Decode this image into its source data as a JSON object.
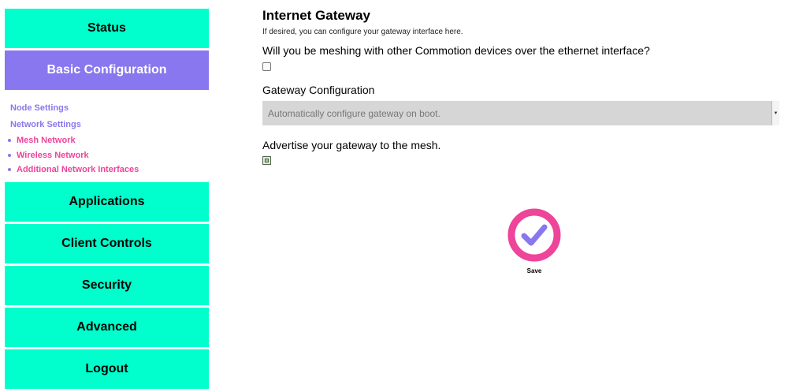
{
  "sidebar": {
    "top_items": [
      {
        "label": "Status"
      },
      {
        "label": "Basic Configuration"
      }
    ],
    "sub_links": [
      "Node Settings",
      "Network Settings"
    ],
    "sub_bullets": [
      "Mesh Network",
      "Wireless Network",
      "Additional Network Interfaces"
    ],
    "bottom_items": [
      {
        "label": "Applications"
      },
      {
        "label": "Client Controls"
      },
      {
        "label": "Security"
      },
      {
        "label": "Advanced"
      },
      {
        "label": "Logout"
      }
    ]
  },
  "main": {
    "title": "Internet Gateway",
    "subtitle": "If desired, you can configure your gateway interface here.",
    "meshing_question": "Will you be meshing with other Commotion devices over the ethernet interface?",
    "meshing_checked": false,
    "gateway_label": "Gateway Configuration",
    "gateway_select_value": "Automatically configure gateway on boot.",
    "advertise_label": "Advertise your gateway to the mesh.",
    "advertise_checked": true,
    "save_label": "Save"
  },
  "colors": {
    "nav_bg": "#00ffcc",
    "nav_active_bg": "#8877ee",
    "sub_link": "#8877ee",
    "sub_bullet": "#ee4499",
    "save_ring": "#ee4499",
    "save_check": "#8877ee"
  }
}
